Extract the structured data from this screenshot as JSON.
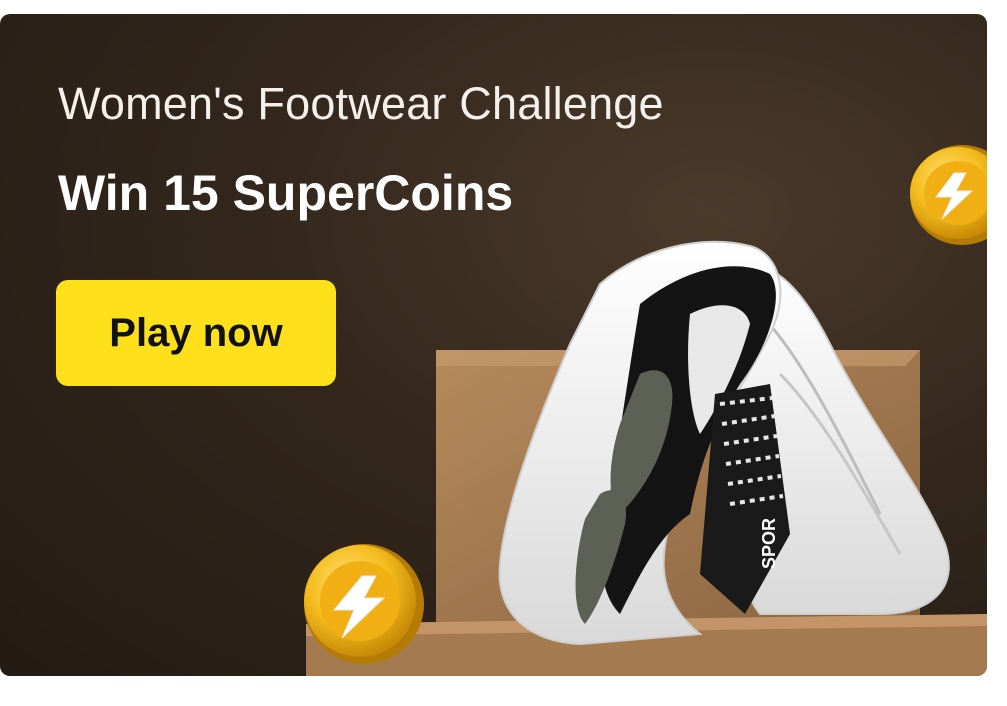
{
  "banner": {
    "title": "Women's Footwear Challenge",
    "subtitle": "Win 15 SuperCoins",
    "cta_label": "Play now",
    "shoe_brand_text": "SPOR",
    "icons": [
      "supercoin-icon",
      "supercoin-icon"
    ],
    "colors": {
      "background": "#2b2119",
      "cta": "#ffe11b",
      "coin": "#f5bd1e"
    }
  }
}
